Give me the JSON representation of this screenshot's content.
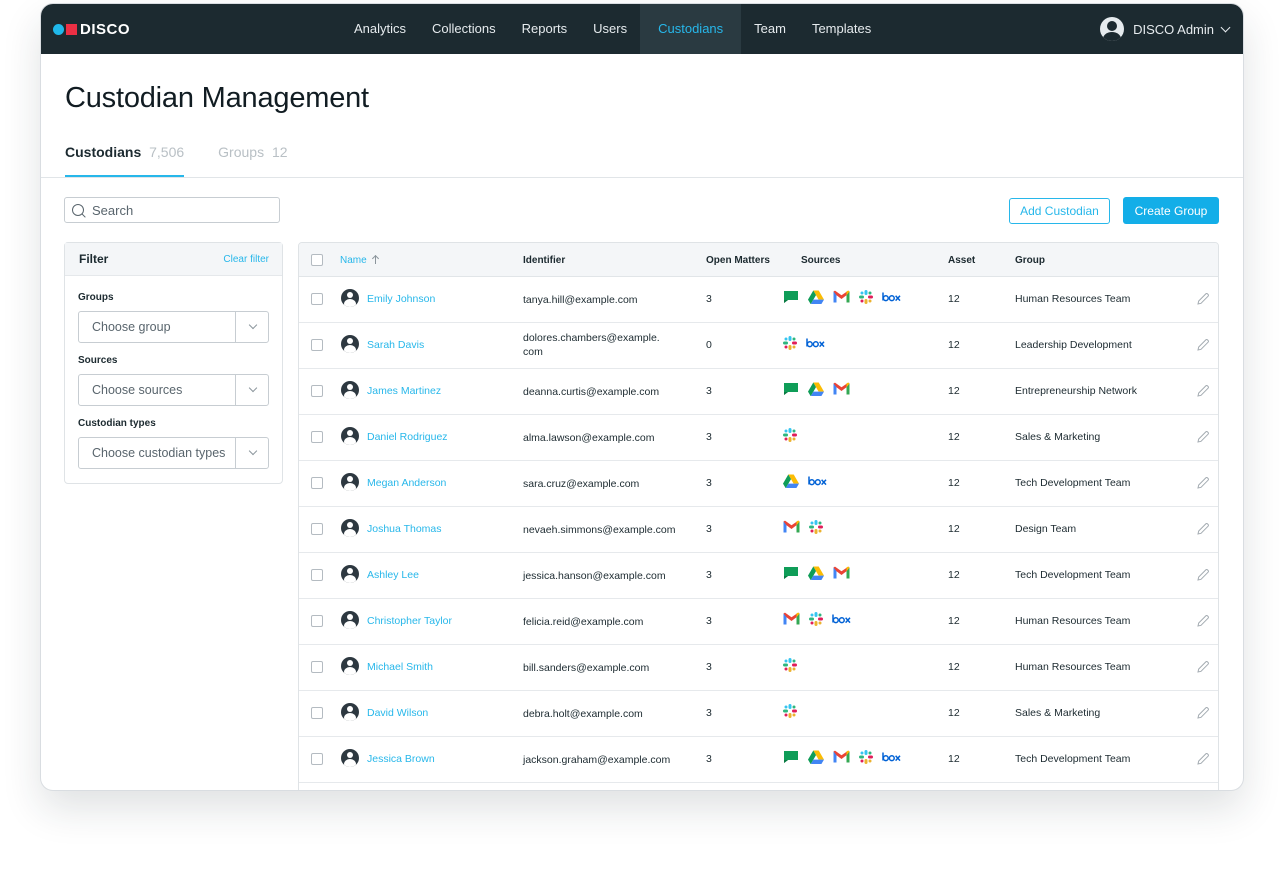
{
  "brand": {
    "name": "DISCO"
  },
  "nav": {
    "items": [
      {
        "label": "Analytics",
        "active": false
      },
      {
        "label": "Collections",
        "active": false
      },
      {
        "label": "Reports",
        "active": false
      },
      {
        "label": "Users",
        "active": false
      },
      {
        "label": "Custodians",
        "active": true
      },
      {
        "label": "Team",
        "active": false
      },
      {
        "label": "Templates",
        "active": false
      }
    ],
    "user": "DISCO Admin"
  },
  "page": {
    "title": "Custodian Management"
  },
  "tabs": [
    {
      "label": "Custodians",
      "count": "7,506",
      "active": true
    },
    {
      "label": "Groups",
      "count": "12",
      "active": false
    }
  ],
  "search": {
    "placeholder": "Search"
  },
  "actions": {
    "add_custodian": "Add Custodian",
    "create_group": "Create Group"
  },
  "filter": {
    "title": "Filter",
    "clear": "Clear filter",
    "groups_label": "Groups",
    "groups_placeholder": "Choose group",
    "sources_label": "Sources",
    "sources_placeholder": "Choose sources",
    "types_label": "Custodian types",
    "types_placeholder": "Choose custodian types"
  },
  "table": {
    "columns": [
      "Name",
      "Identifier",
      "Open Matters",
      "Sources",
      "Asset",
      "Group"
    ],
    "rows": [
      {
        "name": "Emily Johnson",
        "identifier": "tanya.hill@example.com",
        "open_matters": "3",
        "sources": [
          "google-chat",
          "google-drive",
          "gmail",
          "slack",
          "box"
        ],
        "asset": "12",
        "group": "Human Resources Team"
      },
      {
        "name": "Sarah Davis",
        "identifier": "dolores.chambers@example.\ncom",
        "open_matters": "0",
        "sources": [
          "slack",
          "box"
        ],
        "asset": "12",
        "group": "Leadership Development"
      },
      {
        "name": "James Martinez",
        "identifier": "deanna.curtis@example.com",
        "open_matters": "3",
        "sources": [
          "google-chat",
          "google-drive",
          "gmail"
        ],
        "asset": "12",
        "group": "Entrepreneurship Network"
      },
      {
        "name": "Daniel Rodriguez",
        "identifier": "alma.lawson@example.com",
        "open_matters": "3",
        "sources": [
          "slack"
        ],
        "asset": "12",
        "group": "Sales & Marketing"
      },
      {
        "name": "Megan Anderson",
        "identifier": "sara.cruz@example.com",
        "open_matters": "3",
        "sources": [
          "google-drive",
          "box"
        ],
        "asset": "12",
        "group": "Tech Development Team"
      },
      {
        "name": "Joshua Thomas",
        "identifier": "nevaeh.simmons@example.com",
        "open_matters": "3",
        "sources": [
          "gmail",
          "slack"
        ],
        "asset": "12",
        "group": "Design Team"
      },
      {
        "name": "Ashley Lee",
        "identifier": "jessica.hanson@example.com",
        "open_matters": "3",
        "sources": [
          "google-chat",
          "google-drive",
          "gmail"
        ],
        "asset": "12",
        "group": "Tech Development Team"
      },
      {
        "name": "Christopher Taylor",
        "identifier": "felicia.reid@example.com",
        "open_matters": "3",
        "sources": [
          "gmail",
          "slack",
          "box"
        ],
        "asset": "12",
        "group": "Human Resources Team"
      },
      {
        "name": "Michael Smith",
        "identifier": "bill.sanders@example.com",
        "open_matters": "3",
        "sources": [
          "slack"
        ],
        "asset": "12",
        "group": "Human Resources Team"
      },
      {
        "name": "David Wilson",
        "identifier": "debra.holt@example.com",
        "open_matters": "3",
        "sources": [
          "slack"
        ],
        "asset": "12",
        "group": "Sales & Marketing"
      },
      {
        "name": "Jessica Brown",
        "identifier": "jackson.graham@example.com",
        "open_matters": "3",
        "sources": [
          "google-chat",
          "google-drive",
          "gmail",
          "slack",
          "box"
        ],
        "asset": "12",
        "group": "Tech Development Team"
      }
    ]
  },
  "colors": {
    "accent": "#27b7ea",
    "nav_bg": "#1c2a30",
    "button_blue": "#13aee8"
  }
}
